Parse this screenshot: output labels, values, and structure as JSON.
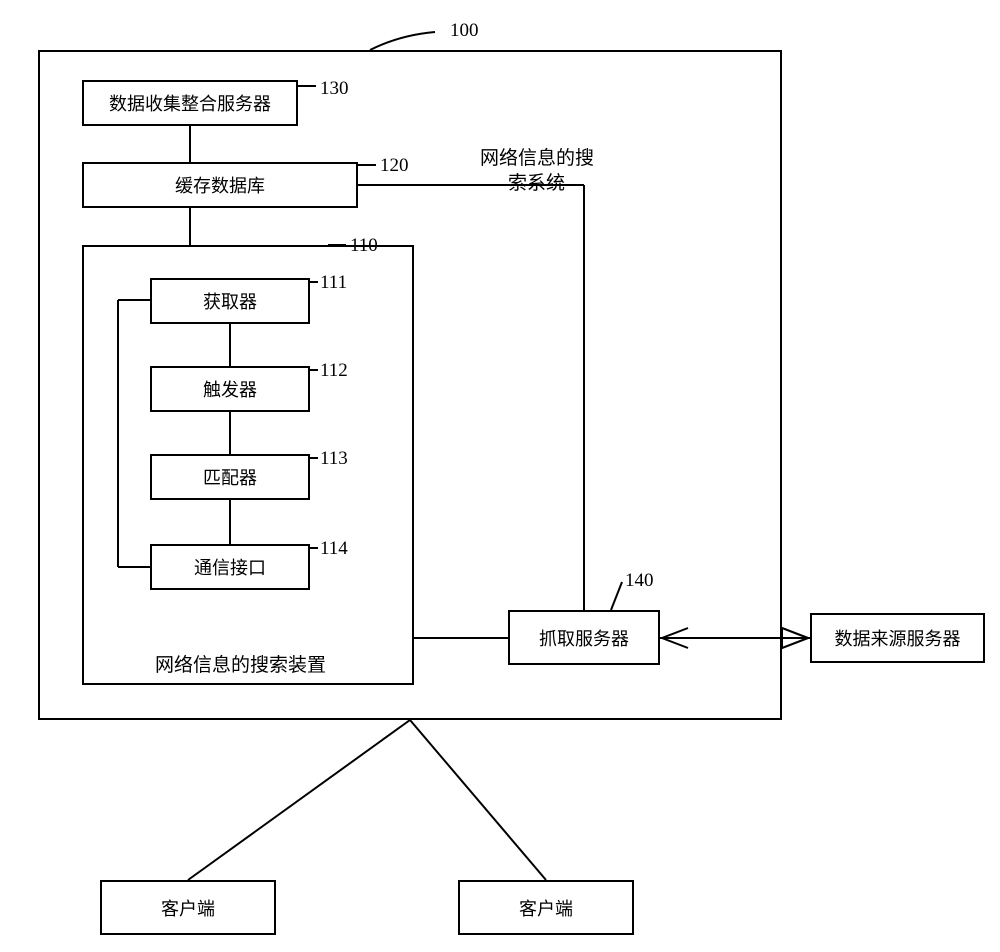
{
  "labels": {
    "system_ref": "100",
    "system_title_l1": "网络信息的搜",
    "system_title_l2": "索系统",
    "block130_label": "数据收集整合服务器",
    "ref130": "130",
    "block120_label": "缓存数据库",
    "ref120": "120",
    "device_title": "网络信息的搜索装置",
    "ref110": "110",
    "block111_label": "获取器",
    "ref111": "111",
    "block112_label": "触发器",
    "ref112": "112",
    "block113_label": "匹配器",
    "ref113": "113",
    "block114_label": "通信接口",
    "ref114": "114",
    "block140_label": "抓取服务器",
    "ref140": "140",
    "src_server_label": "数据来源服务器",
    "client_label": "客户端"
  }
}
